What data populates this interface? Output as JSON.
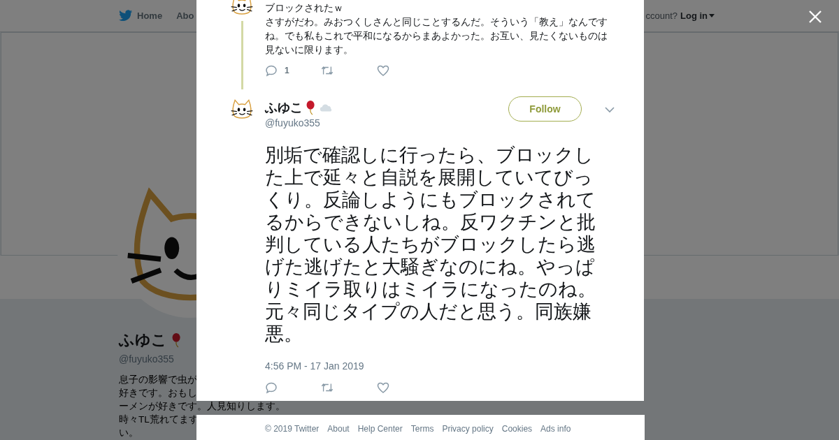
{
  "top_nav": {
    "items": [
      {
        "label": "Home",
        "kind": "home"
      },
      {
        "label": "Abo",
        "kind": "plain"
      }
    ],
    "account_prompt": "ccount?",
    "login": "Log in"
  },
  "profile": {
    "name": "ふゆこ",
    "handle": "@fuyuko355",
    "bio_lines": [
      "息子の影響で虫が",
      "好きです。おもし",
      "ーメンが好きです。人見知りします。",
      "時々TL荒れてます",
      "い。"
    ]
  },
  "modal": {
    "previous_tweet": {
      "lines": [
        "ブロックされたｗ",
        "さすがだわ。みおつくしさんと同じことするんだ。そういう「教え」なんですね。でも私もこれで平和になるからまあよかった。お互い、見たくないものは見ないに限ります。"
      ],
      "reply_count": "1"
    },
    "tweet": {
      "name": "ふゆこ",
      "handle": "@fuyuko355",
      "follow": "Follow",
      "text_paragraphs": [
        "別垢で確認しに行ったら、ブロックした上で延々と自説を展開していてびっくり。反論しようにもブロックされてるからできないしね。反ワクチンと批判している人たちがブロックしたら逃げた逃げたと大騒ぎなのにね。やっぱりミイラ取りはミイラになったのね。",
        "元々同じタイプの人だと思う。同族嫌悪。"
      ],
      "time": "4:56 PM - 17 Jan 2019"
    }
  },
  "footer": [
    "© 2019 Twitter",
    "About",
    "Help Center",
    "Terms",
    "Privacy policy",
    "Cookies",
    "Ads info"
  ]
}
